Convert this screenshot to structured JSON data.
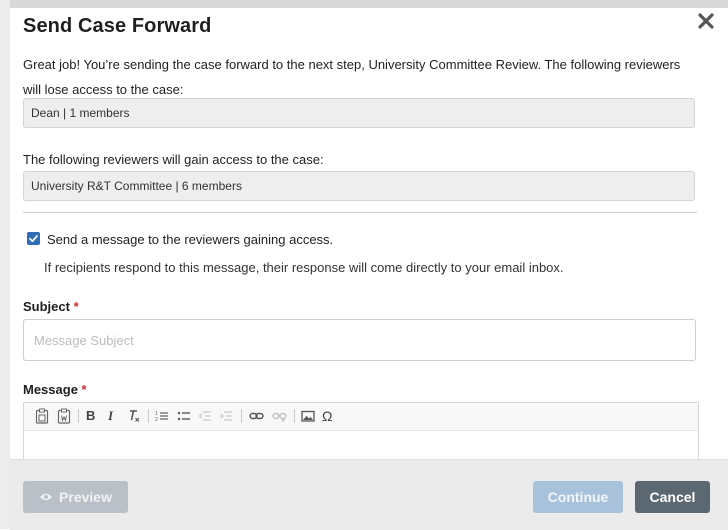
{
  "modal": {
    "title": "Send Case Forward",
    "close_icon": "close-icon"
  },
  "intro": {
    "text": "Great job! You’re sending the case forward to the next step, University Committee Review. The following reviewers will lose access to the case:"
  },
  "losing_access": {
    "value": "Dean | 1 members"
  },
  "gaining_access": {
    "label": "The following reviewers will gain access to the case:",
    "value": "University R&T Committee | 6 members"
  },
  "message_option": {
    "checked": true,
    "label": "Send a message to the reviewers gaining access.",
    "hint": "If recipients respond to this message, their response will come directly to your email inbox."
  },
  "subject": {
    "label": "Subject",
    "required_mark": "*",
    "placeholder": "Message Subject",
    "value": ""
  },
  "message": {
    "label": "Message",
    "required_mark": "*",
    "toolbar": [
      "paste-icon",
      "paste-from-word-icon",
      "bold-icon",
      "italic-icon",
      "remove-format-icon",
      "numbered-list-icon",
      "bulleted-list-icon",
      "decrease-indent-icon",
      "increase-indent-icon",
      "link-icon",
      "unlink-icon",
      "image-icon",
      "special-character-icon"
    ],
    "toolbar_text": {
      "bold": "B",
      "italic": "I",
      "omega": "Ω"
    }
  },
  "footer": {
    "preview_label": "Preview",
    "continue_label": "Continue",
    "cancel_label": "Cancel"
  },
  "colors": {
    "checkbox": "#2f6eb5",
    "required": "#c9302c",
    "cancel_button": "#5b6872",
    "continue_button_disabled": "#a7c2da",
    "preview_button_disabled": "#b9c0c7"
  }
}
